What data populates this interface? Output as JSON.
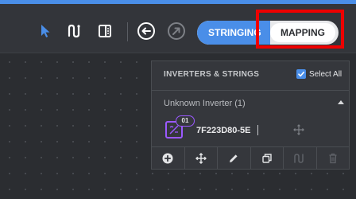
{
  "toolbar": {
    "tools": [
      {
        "name": "select-pointer",
        "icon": "cursor-icon",
        "active": true,
        "color": "#4a8ee8"
      },
      {
        "name": "string-route",
        "icon": "route-icon"
      },
      {
        "name": "panel-toggle",
        "icon": "sidebar-panel-icon"
      },
      {
        "name": "undo",
        "icon": "undo-icon"
      },
      {
        "name": "redo",
        "icon": "redo-icon",
        "disabled": true
      }
    ],
    "mode_toggle": {
      "left_label": "STRINGING",
      "right_label": "MAPPING",
      "selected": "MAPPING"
    }
  },
  "panel": {
    "title": "INVERTERS & STRINGS",
    "select_all_label": "Select All",
    "select_all_checked": true,
    "group": {
      "label": "Unknown Inverter (1)",
      "expanded": true
    },
    "inverters": [
      {
        "badge": "01",
        "label": "7F223D80-5E"
      }
    ],
    "footer_actions": [
      {
        "name": "add",
        "icon": "plus-circle-icon"
      },
      {
        "name": "move",
        "icon": "move-icon"
      },
      {
        "name": "edit",
        "icon": "pencil-icon"
      },
      {
        "name": "duplicate",
        "icon": "copy-icon"
      },
      {
        "name": "route",
        "icon": "route-icon",
        "disabled": true
      },
      {
        "name": "delete",
        "icon": "trash-icon",
        "disabled": true
      }
    ]
  },
  "colors": {
    "accent": "#4a8ee8",
    "highlight": "#ee0000",
    "inverter": "#9b59ff",
    "canvas": "#2b2d31",
    "panel": "#35373c"
  }
}
